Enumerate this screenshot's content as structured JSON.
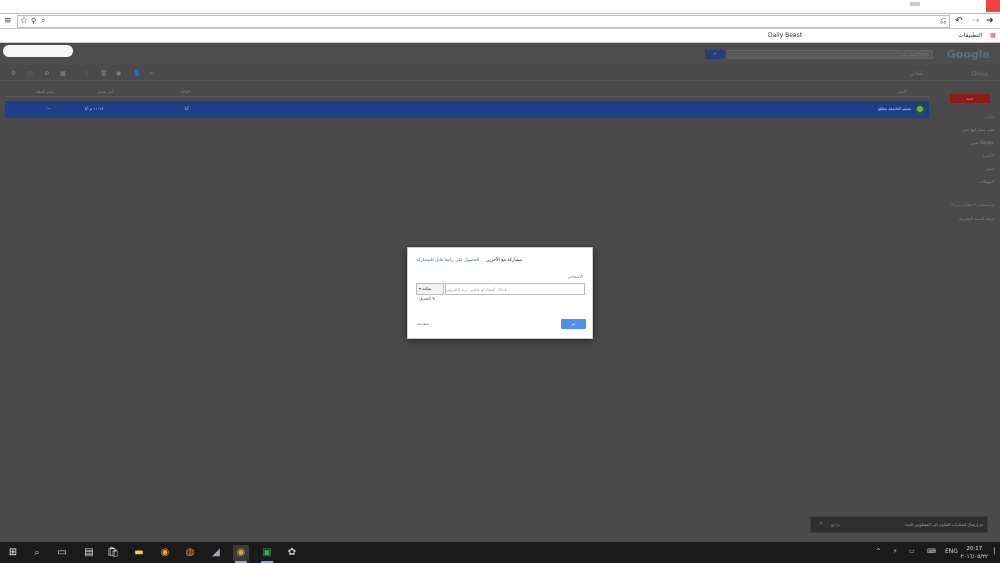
{
  "browser": {
    "bookmarks": [
      "Daily Beast",
      "التطبيقات"
    ]
  },
  "drive": {
    "logo": "Google",
    "product_name": "Drive",
    "search_placeholder": "البحث في Drive",
    "my_drive_label": "ملفاتي",
    "new_button": "جديد",
    "columns": [
      "الاسم",
      "المالك",
      "آخر تعديل",
      "حجم الملف"
    ],
    "file": {
      "name": "ستيم العاشقة مطلع",
      "owner": "أنا",
      "modified": "١١:١٧ م أنا",
      "size": "—"
    },
    "sidebar_items": [
      "ملفاتي",
      "تمت مشاركتها معي",
      "صور Google",
      "الأخيرة",
      "مميز",
      "المهملات"
    ],
    "storage": "تم استخدام ٣ غيغابايت من ١٥",
    "upgrade": "ترقية السعة التخزينية"
  },
  "dialog": {
    "title": "مشاركة مع الآخرين",
    "get_link": "الحصول على رابط قابل للمشاركة",
    "people_label": "الأشخاص",
    "input_placeholder": "إدخال أسماء أو عناوين بريد إلكتروني...",
    "permission": "يمكنه التعديل",
    "done": "تم",
    "advanced": "متقدمة"
  },
  "toast": {
    "message": "تم إرسال إشعارات التعاون إلى المتعاونين الجدد",
    "undo": "تراجع"
  },
  "taskbar": {
    "language": "ENG",
    "time": "20:17",
    "date": "٢٠١٦/٠٥/٢٢"
  }
}
